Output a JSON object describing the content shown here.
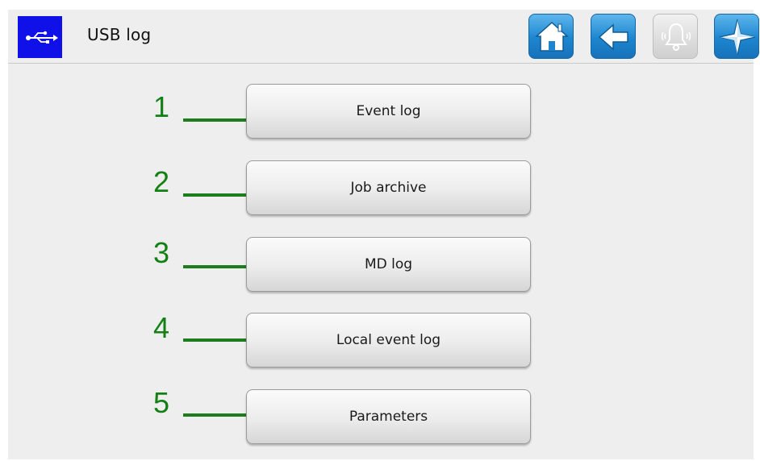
{
  "header": {
    "title": "USB log",
    "icons": [
      "usb-icon",
      "home-icon",
      "back-arrow-icon",
      "alarm-bell-icon",
      "compass-star-icon"
    ],
    "accent_color": "#1010e8"
  },
  "menu": [
    {
      "number": "1",
      "label": "Event log"
    },
    {
      "number": "2",
      "label": "Job archive"
    },
    {
      "number": "3",
      "label": "MD log"
    },
    {
      "number": "4",
      "label": "Local event log"
    },
    {
      "number": "5",
      "label": "Parameters"
    }
  ],
  "colors": {
    "callout": "#138013",
    "button_blue": "#1d86cf"
  }
}
